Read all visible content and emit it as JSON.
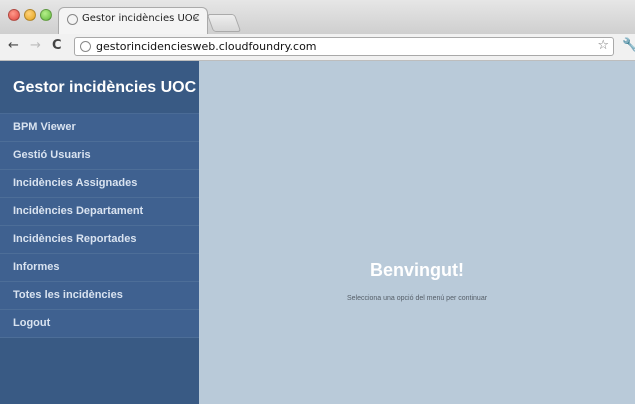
{
  "browser": {
    "tab_title": "Gestor incidències UOC",
    "tab_close": "×",
    "back": "←",
    "forward": "→",
    "reload": "C",
    "url": "gestorincidenciesweb.cloudfoundry.com",
    "bookmark_star": "☆",
    "wrench": "🔧"
  },
  "sidebar": {
    "brand": "Gestor incidències UOC",
    "items": [
      {
        "label": "BPM Viewer"
      },
      {
        "label": "Gestió Usuaris"
      },
      {
        "label": "Incidències Assignades"
      },
      {
        "label": "Incidències Departament"
      },
      {
        "label": "Incidències Reportades"
      },
      {
        "label": "Informes"
      },
      {
        "label": "Totes les incidències"
      },
      {
        "label": "Logout"
      }
    ]
  },
  "main": {
    "heading": "Benvingut!",
    "subtitle": "Selecciona una opció del menú per continuar"
  },
  "colors": {
    "sidebar_bg": "#395a84",
    "menu_item_bg": "#3f6190",
    "main_bg": "#b9cad9"
  }
}
